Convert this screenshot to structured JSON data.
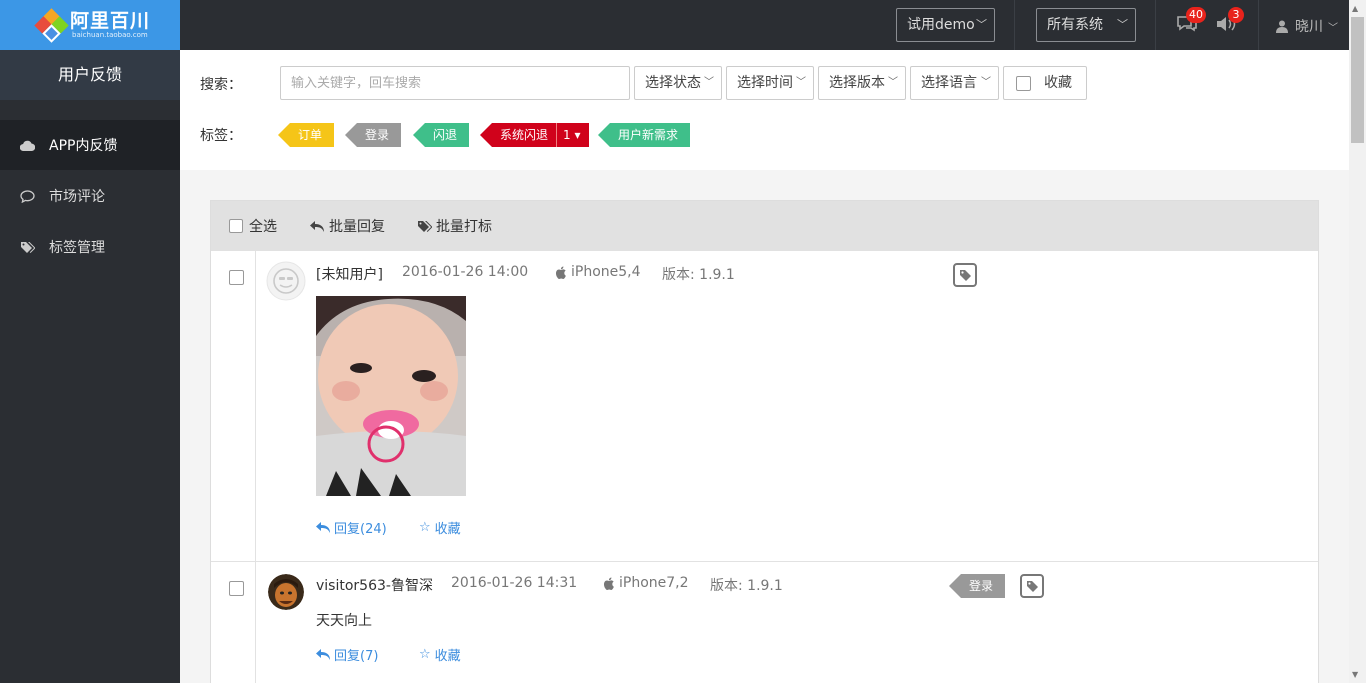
{
  "brand": {
    "name": "阿里百川",
    "domain": "baichuan.taobao.com"
  },
  "topbar": {
    "app_select": "试用demo",
    "system_select": "所有系统",
    "messages_count": "40",
    "notifications_count": "3",
    "user_name": "晓川"
  },
  "sidebar": {
    "title": "用户反馈",
    "items": [
      {
        "label": "APP内反馈",
        "icon": "cloud-icon",
        "active": true
      },
      {
        "label": "市场评论",
        "icon": "comment-icon",
        "active": false
      },
      {
        "label": "标签管理",
        "icon": "tags-icon",
        "active": false
      }
    ]
  },
  "filter": {
    "search_label": "搜索：",
    "search_placeholder": "输入关键字，回车搜索",
    "status_select": "选择状态",
    "time_select": "选择时间",
    "version_select": "选择版本",
    "language_select": "选择语言",
    "favorite_label": "收藏",
    "tags_label": "标签：",
    "tags": [
      {
        "label": "订单",
        "color": "#f5c518",
        "text_color": "#ffffff"
      },
      {
        "label": "登录",
        "color": "#999999",
        "text_color": "#ffffff"
      },
      {
        "label": "闪退",
        "color": "#3fbf8a",
        "text_color": "#ffffff"
      },
      {
        "label": "系统闪退",
        "color": "#d0021b",
        "text_color": "#ffffff",
        "count": "1"
      },
      {
        "label": "用户新需求",
        "color": "#3fbf8a",
        "text_color": "#ffffff"
      }
    ]
  },
  "toolbar": {
    "select_all": "全选",
    "batch_reply": "批量回复",
    "batch_tag": "批量打标"
  },
  "feedbacks": [
    {
      "user": "[未知用户]",
      "time": "2016-01-26 14:00",
      "device": "iPhone5,4",
      "version": "版本: 1.9.1",
      "reply": "回复(24)",
      "favorite": "收藏"
    },
    {
      "user": "visitor563-鲁智深",
      "time": "2016-01-26 14:31",
      "device": "iPhone7,2",
      "version": "版本: 1.9.1",
      "content": "天天向上",
      "tag": "登录",
      "reply": "回复(7)",
      "favorite": "收藏"
    }
  ]
}
